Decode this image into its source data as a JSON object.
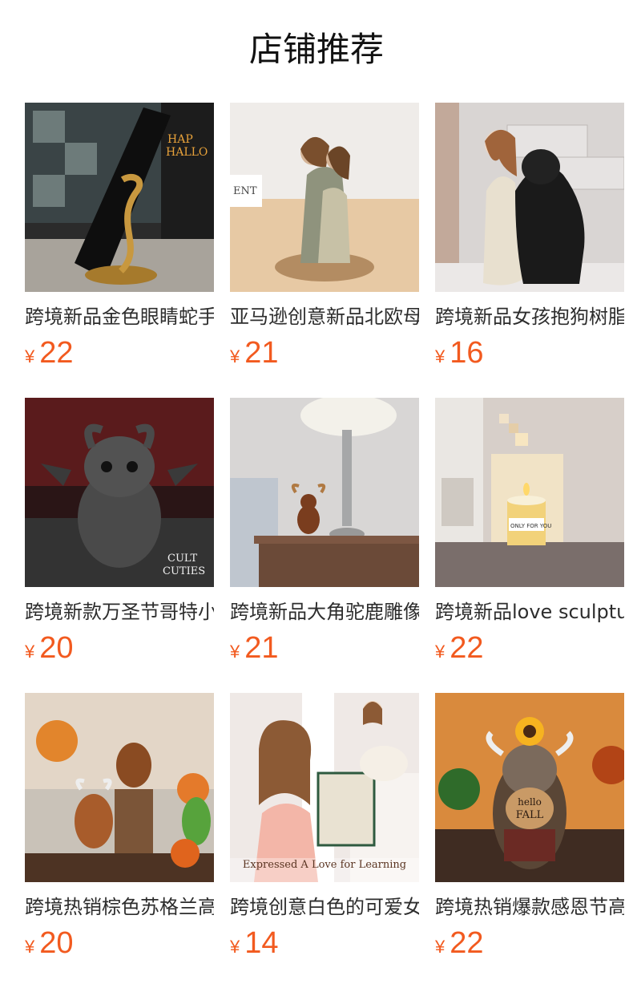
{
  "section": {
    "title": "店铺推荐"
  },
  "products": [
    {
      "title": "跨境新品金色眼睛蛇手机支架",
      "currency": "¥",
      "price": "22",
      "image": "golden-snake-phone-stand"
    },
    {
      "title": "亚马逊创意新品北欧母女拥抱摆件",
      "currency": "¥",
      "price": "21",
      "image": "mother-daughter-hug-figurine"
    },
    {
      "title": "跨境新品女孩抱狗树脂摆件",
      "currency": "¥",
      "price": "16",
      "image": "girl-hugging-dog-figurine"
    },
    {
      "title": "跨境新款万圣节哥特小怪兽摆件",
      "currency": "¥",
      "price": "20",
      "image": "gothic-winged-creature-figurine"
    },
    {
      "title": "跨境新品大角驼鹿雕像摆件",
      "currency": "¥",
      "price": "21",
      "image": "moose-figurine-by-lamp"
    },
    {
      "title": "跨境新品love sculpture",
      "currency": "¥",
      "price": "22",
      "image": "candle-holder-sculpture"
    },
    {
      "title": "跨境热销棕色苏格兰高地牛摆件",
      "currency": "¥",
      "price": "20",
      "image": "highland-cow-figurines"
    },
    {
      "title": "跨境创意白色的可爱女孩读书摆件",
      "currency": "¥",
      "price": "14",
      "image": "girl-reading-figurine"
    },
    {
      "title": "跨境热销爆款感恩节高地牛摆件",
      "currency": "¥",
      "price": "22",
      "image": "thanksgiving-highland-cow"
    }
  ],
  "image_captions": {
    "product_7": "Expressed A Love for Learning",
    "product_3_logo": "CULT CUTIES",
    "product_5_candle": "ONLY FOR YOU"
  },
  "colors": {
    "price": "#f25a1f",
    "title_text": "#2d2d2d",
    "heading": "#111111"
  }
}
